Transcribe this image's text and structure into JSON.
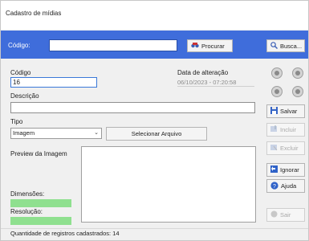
{
  "window": {
    "title": "Cadastro de mídias"
  },
  "search": {
    "label": "Código:",
    "value": "",
    "procurar_label": "Procurar",
    "busca_label": "Busca..."
  },
  "form": {
    "codigo_label": "Código",
    "codigo_value": "16",
    "data_label": "Data de alteração",
    "data_value": "06/10/2023 - 07:20:58",
    "descricao_label": "Descrição",
    "descricao_value": "",
    "tipo_label": "Tipo",
    "tipo_value": "Imagem",
    "selecionar_label": "Selecionar Arquivo",
    "preview_label": "Preview da Imagem",
    "dimensoes_label": "Dimensões:",
    "resolucao_label": "Resolução:"
  },
  "side": {
    "salvar": "Salvar",
    "incluir": "Incluir",
    "excluir": "Excluir",
    "ignorar": "Ignorar",
    "ajuda": "Ajuda",
    "sair": "Sair"
  },
  "status": {
    "text": "Quantidade de registros cadastrados:  14"
  },
  "colors": {
    "topbar": "#3f6ddb",
    "green": "#8fe08f"
  }
}
